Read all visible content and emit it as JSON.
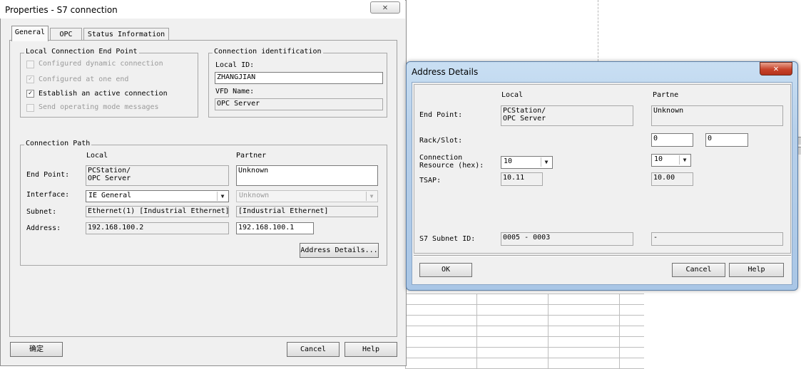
{
  "properties_dialog": {
    "title": "Properties - S7 connection",
    "close_glyph": "✕",
    "tabs": [
      {
        "label": "General",
        "active": true
      },
      {
        "label": "OPC",
        "active": false
      },
      {
        "label": "Status Information",
        "active": false
      }
    ],
    "local_endpoint": {
      "label": "Local Connection End Point",
      "options": [
        {
          "label": "Configured dynamic connection",
          "checked": false,
          "enabled": false
        },
        {
          "label": "Configured at one end",
          "checked": true,
          "enabled": false
        },
        {
          "label": "Establish an active connection",
          "checked": true,
          "enabled": true
        },
        {
          "label": "Send operating mode messages",
          "checked": false,
          "enabled": false
        }
      ],
      "check_glyph": "✓"
    },
    "connection_identification": {
      "label": "Connection identification",
      "local_id_label": "Local ID:",
      "local_id_value": "ZHANGJIAN",
      "vfd_label": "VFD Name:",
      "vfd_value": "OPC Server"
    },
    "connection_path": {
      "label": "Connection Path",
      "col_local": "Local",
      "col_partner": "Partner",
      "end_point_label": "End Point:",
      "local_end_point": "PCStation/\nOPC Server",
      "partner_end_point": "Unknown",
      "interface_label": "Interface:",
      "local_interface": "IE General",
      "partner_interface": "Unknown",
      "subnet_label": "Subnet:",
      "local_subnet": "Ethernet(1) [Industrial Ethernet]",
      "partner_subnet": "[Industrial Ethernet]",
      "address_label": "Address:",
      "local_address": "192.168.100.2",
      "partner_address": "192.168.100.1",
      "address_details_button": "Address Details..."
    },
    "buttons": {
      "ok": "确定",
      "cancel": "Cancel",
      "help": "Help"
    },
    "dropdown_glyph": "▼"
  },
  "address_details": {
    "title": "Address Details",
    "close_glyph": "✕",
    "col_local": "Local",
    "col_partner": "Partne",
    "end_point_label": "End Point:",
    "local_end_point": "PCStation/\nOPC Server",
    "partner_end_point": "Unknown",
    "rack_slot_label": "Rack/Slot:",
    "partner_rack": "0",
    "partner_slot": "0",
    "conn_resource_label": "Connection\nResource (hex):",
    "local_resource": "10",
    "partner_resource": "10",
    "tsap_label": "TSAP:",
    "local_tsap": "10.11",
    "partner_tsap": "10.00",
    "subnet_id_label": "S7 Subnet ID:",
    "local_subnet_id": "0005 - 0003",
    "partner_subnet_id": "-",
    "buttons": {
      "ok": "OK",
      "cancel": "Cancel",
      "help": "Help"
    },
    "dropdown_glyph": "▼"
  }
}
